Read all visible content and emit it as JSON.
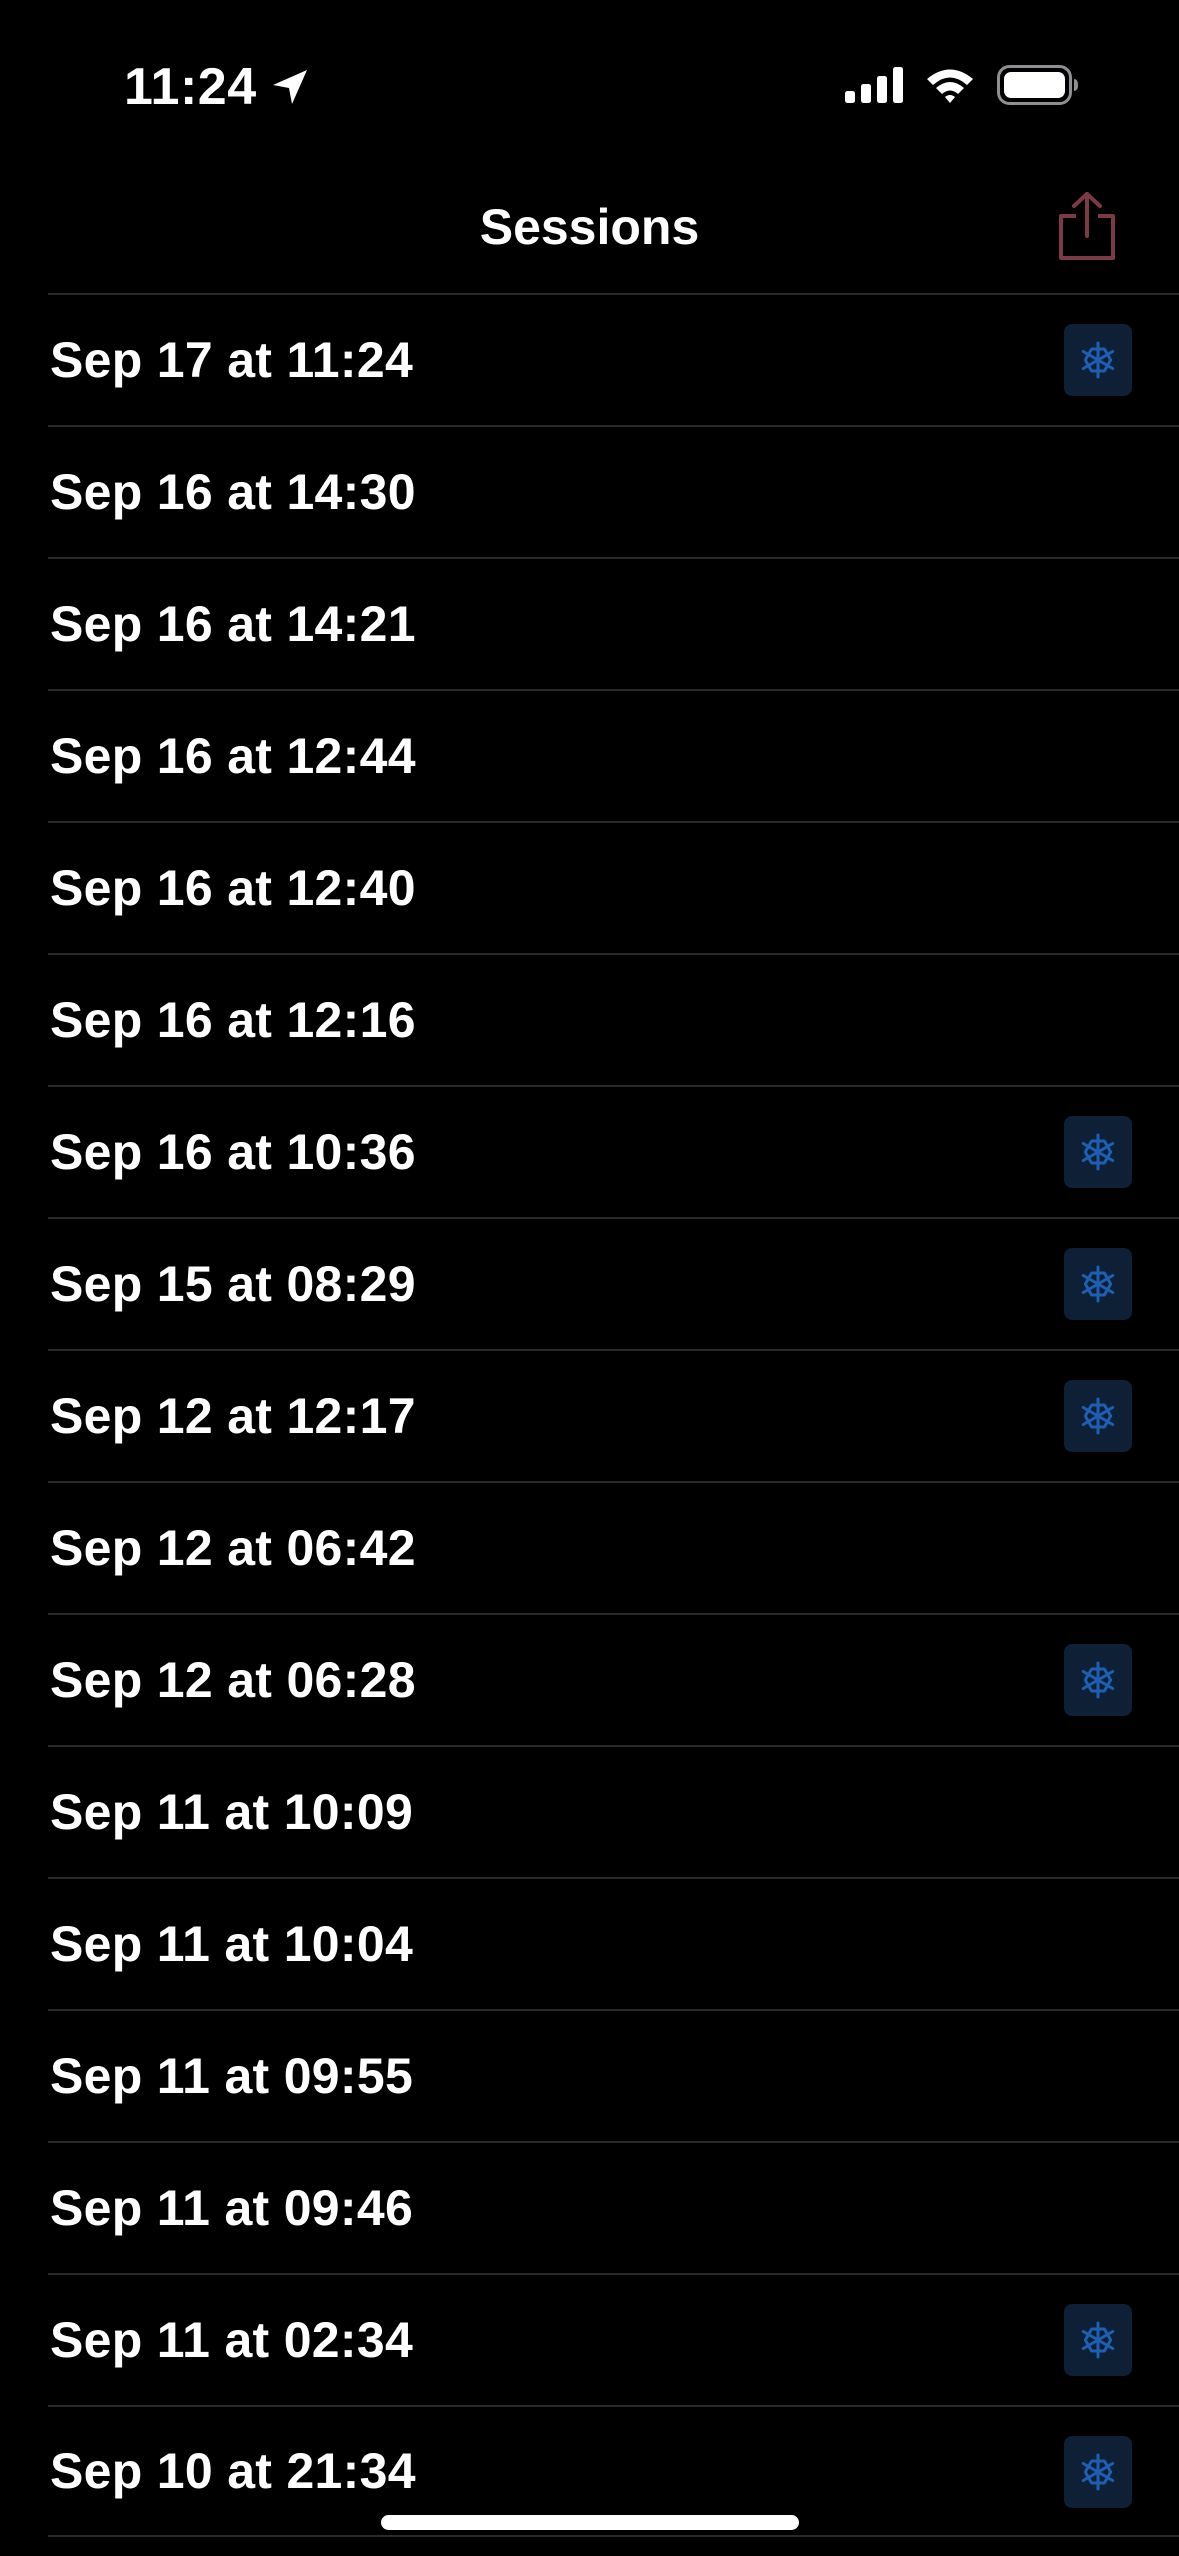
{
  "status_bar": {
    "time": "11:24",
    "icons": [
      "location-arrow-icon",
      "cellular-signal-icon",
      "wifi-icon",
      "battery-icon"
    ]
  },
  "nav": {
    "title": "Sessions",
    "share_icon": "share-icon",
    "share_color": "#7a3b46"
  },
  "colors": {
    "background": "#000000",
    "text": "#ffffff",
    "separator": "#2a2a2c",
    "badge_background": "#0d2036",
    "badge_icon": "#1e5fb3"
  },
  "sessions": [
    {
      "label": "Sep 17 at 11:24",
      "frozen": true
    },
    {
      "label": "Sep 16 at 14:30",
      "frozen": false
    },
    {
      "label": "Sep 16 at 14:21",
      "frozen": false
    },
    {
      "label": "Sep 16 at 12:44",
      "frozen": false
    },
    {
      "label": "Sep 16 at 12:40",
      "frozen": false
    },
    {
      "label": "Sep 16 at 12:16",
      "frozen": false
    },
    {
      "label": "Sep 16 at 10:36",
      "frozen": true
    },
    {
      "label": "Sep 15 at 08:29",
      "frozen": true
    },
    {
      "label": "Sep 12 at 12:17",
      "frozen": true
    },
    {
      "label": "Sep 12 at 06:42",
      "frozen": false
    },
    {
      "label": "Sep 12 at 06:28",
      "frozen": true
    },
    {
      "label": "Sep 11 at 10:09",
      "frozen": false
    },
    {
      "label": "Sep 11 at 10:04",
      "frozen": false
    },
    {
      "label": "Sep 11 at 09:55",
      "frozen": false
    },
    {
      "label": "Sep 11 at 09:46",
      "frozen": false
    },
    {
      "label": "Sep 11 at 02:34",
      "frozen": true
    },
    {
      "label": "Sep 10 at 21:34",
      "frozen": true
    }
  ]
}
